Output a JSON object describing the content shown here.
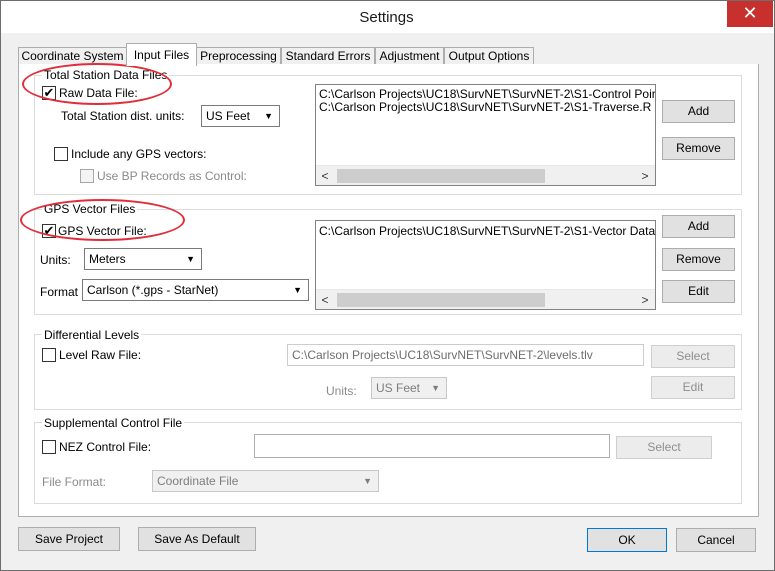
{
  "window": {
    "title": "Settings",
    "close_glyph": "✕"
  },
  "tabs": [
    {
      "label": "Coordinate System"
    },
    {
      "label": "Input Files"
    },
    {
      "label": "Preprocessing"
    },
    {
      "label": "Standard Errors"
    },
    {
      "label": "Adjustment"
    },
    {
      "label": "Output Options"
    }
  ],
  "active_tab": "Input Files",
  "total_station": {
    "group_title": "Total Station Data Files",
    "raw_data_label": "Raw Data File:",
    "raw_data_checked": true,
    "dist_units_label": "Total Station dist. units:",
    "dist_units_value": "US Feet",
    "include_gps_label": "Include any GPS vectors:",
    "include_gps_checked": false,
    "use_bp_label": "Use BP Records as Control:",
    "use_bp_checked": false,
    "files": [
      "C:\\Carlson Projects\\UC18\\SurvNET\\SurvNET-2\\S1-Control Poir",
      "C:\\Carlson Projects\\UC18\\SurvNET\\SurvNET-2\\S1-Traverse.R"
    ],
    "add_label": "Add",
    "remove_label": "Remove"
  },
  "gps": {
    "group_title": "GPS Vector Files",
    "vector_label": "GPS Vector File:",
    "vector_checked": true,
    "units_label": "Units:",
    "units_value": "Meters",
    "format_label": "Format",
    "format_value": "Carlson (*.gps - StarNet)",
    "files": [
      "C:\\Carlson Projects\\UC18\\SurvNET\\SurvNET-2\\S1-Vector Data"
    ],
    "add_label": "Add",
    "remove_label": "Remove",
    "edit_label": "Edit"
  },
  "levels": {
    "group_title": "Differential Levels",
    "raw_label": "Level Raw File:",
    "raw_checked": false,
    "path_value": "C:\\Carlson Projects\\UC18\\SurvNET\\SurvNET-2\\levels.tlv",
    "select_label": "Select",
    "units_label": "Units:",
    "units_value": "US Feet",
    "edit_label": "Edit"
  },
  "supplemental": {
    "group_title": "Supplemental Control File",
    "nez_label": "NEZ Control File:",
    "nez_checked": false,
    "path_value": "",
    "select_label": "Select",
    "format_label": "File Format:",
    "format_value": "Coordinate File"
  },
  "footer": {
    "save_project": "Save Project",
    "save_default": "Save As Default",
    "ok": "OK",
    "cancel": "Cancel"
  },
  "icons": {
    "checkmark": "✔",
    "dropdown": "▼",
    "scroll_left": "<",
    "scroll_right": ">"
  },
  "colors": {
    "close_button": "#c7302c",
    "annotation_ellipse": "#e02d3a",
    "default_button_border": "#0078d7"
  }
}
